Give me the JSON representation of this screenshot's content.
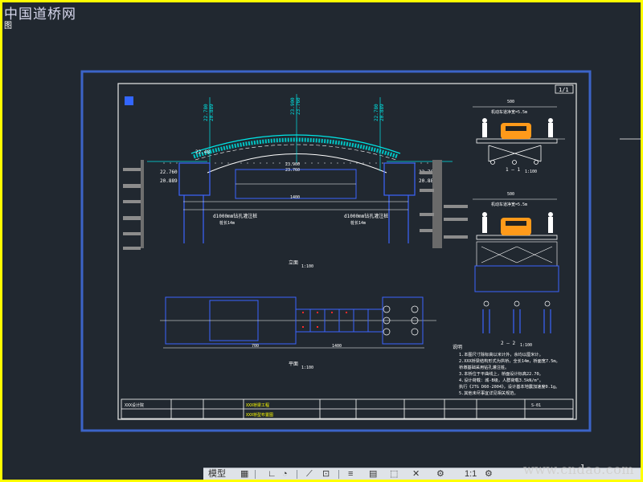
{
  "watermark": {
    "site_name": "中国道桥网",
    "site_url": "www.cndao.com",
    "tiny_char": "图"
  },
  "drawing": {
    "page_no": "1/1",
    "elevations": {
      "left": "22.760",
      "left2": "20.889",
      "left_mid": "22.40",
      "right": "22.760",
      "right2": "20.889",
      "center": "23.900",
      "center2": "23.760",
      "top_left": "22.48"
    },
    "dims": {
      "span": "1400",
      "half": "700",
      "deck_w": "1000",
      "top_total": "1000"
    },
    "pile_note_left": "d1000mm钻孔灌注桩",
    "pile_note_left2": "桩长14m",
    "pile_note_right": "d1000mm钻孔灌注桩",
    "pile_note_right2": "桩长14m",
    "elev_title": "立面",
    "elev_scale": "1:100",
    "plan_title": "平面",
    "plan_scale": "1:100",
    "section1_label": "1 — 1",
    "section1_scale": "1:100",
    "section2_label": "2 — 2",
    "section2_scale": "1:100",
    "section1_top_dim": "500",
    "section1_sub_dim": "机动车道净宽=5.5m",
    "section2_top_dim": "500",
    "section2_sub_dim": "机动车道净宽=5.5m",
    "notes_header": "说明",
    "notes": [
      "1.本图尺寸除标高以米计外，余均以厘米计。",
      "2.XXX桥梁结构形式为拱桥，全长14m，桥面宽7.5m。",
      "  桥墩基础采用钻孔灌注桩。",
      "3.本桥位于平曲线上，桥面设计标高22.70。",
      "4.设计荷载：城-B级，人群荷载3.5kN/m²。",
      "  执行《JTG D60-2004》，设计基本地震加速度0.1g。",
      "5.其他未尽事宜详见相关规范。"
    ],
    "title_block": {
      "company": "XXX设计院",
      "project": "XXX桥梁工程",
      "drawing_title": "XXX桥型布置图",
      "sheet": "S-01"
    }
  },
  "status_bar": {
    "model_tab": "模型",
    "grid_icon": "grid-icon",
    "snap_icon": "snap-icon",
    "ortho_icon": "ortho-icon",
    "polar_icon": "polar-icon",
    "osnap_icon": "osnap-icon",
    "annotation_icon": "annotation-icon",
    "scale_value": "1:1",
    "settings_icon": "gear-icon"
  },
  "colors": {
    "background": "#212830",
    "border_frame": "#3c64c8",
    "cad_white": "#ffffff",
    "cad_cyan": "#00e5e5",
    "cad_blue": "#2a3cff",
    "cad_yellow": "#ffff00",
    "cad_orange": "#ff9a1a",
    "cad_green": "#33cc33",
    "cad_gray": "#8c8c8c"
  }
}
